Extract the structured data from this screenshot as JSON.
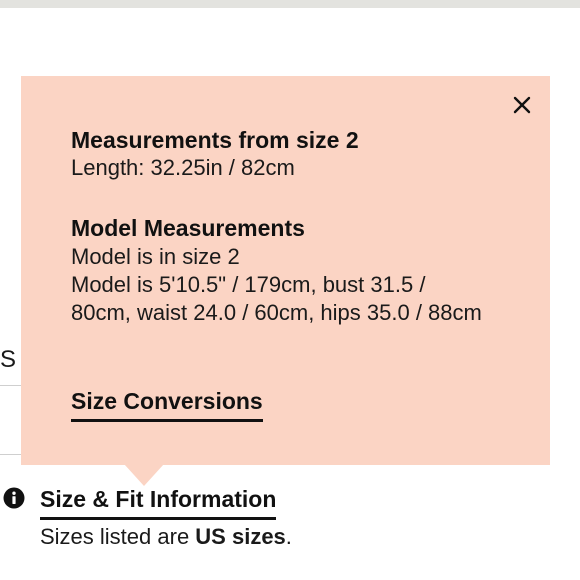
{
  "page": {
    "background_letter": "S"
  },
  "popover": {
    "background_color": "#fbd4c4",
    "close_icon": "close-icon",
    "measurements": {
      "title": "Measurements from size 2",
      "length": "Length: 32.25in / 82cm"
    },
    "model": {
      "title": "Model Measurements",
      "size_line": "Model is in size 2",
      "details": "Model is 5'10.5\" / 179cm, bust 31.5 / 80cm, waist 24.0 / 60cm, hips 35.0 / 88cm"
    },
    "conversions_link": "Size Conversions"
  },
  "size_fit": {
    "info_icon": "info-circle-icon",
    "link_label": "Size & Fit Information",
    "note_prefix": "Sizes listed are ",
    "note_bold": "US sizes",
    "note_suffix": "."
  }
}
